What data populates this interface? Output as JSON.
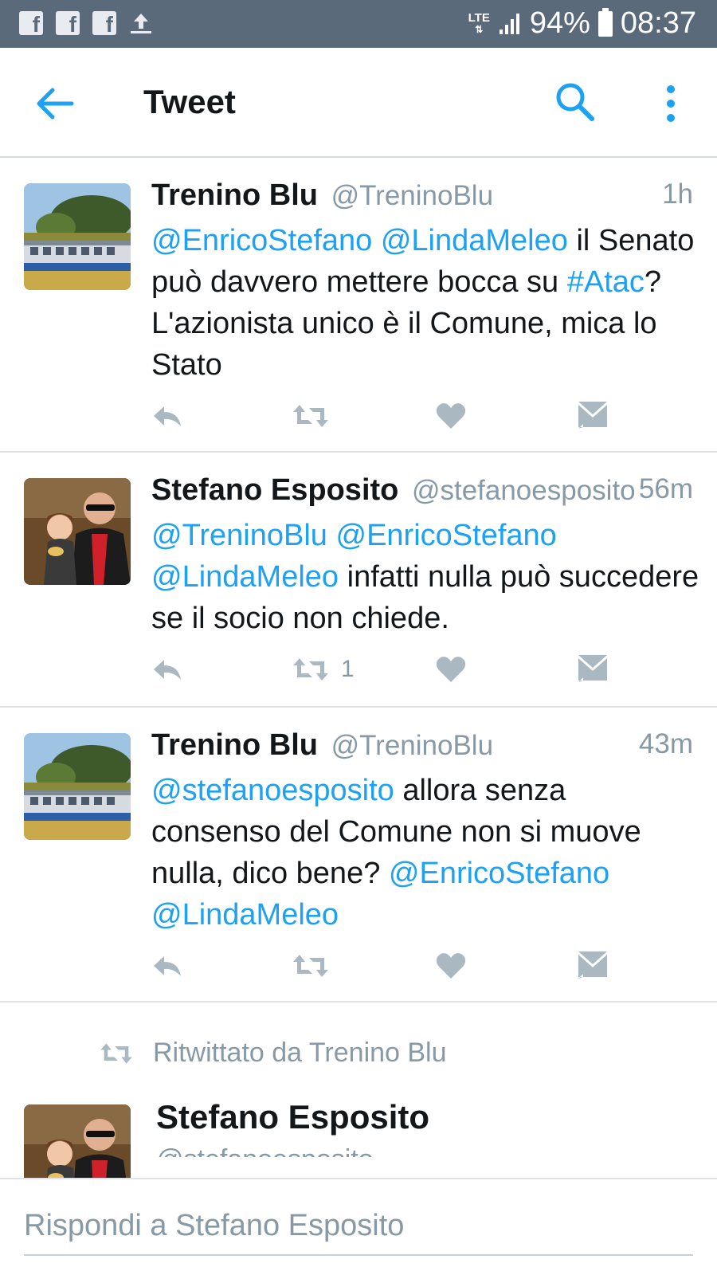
{
  "status_bar": {
    "network": "LTE",
    "battery": "94%",
    "time": "08:37"
  },
  "appbar": {
    "title": "Tweet"
  },
  "tweets": [
    {
      "name": "Trenino Blu",
      "handle": "@TreninoBlu",
      "time": "1h",
      "text": [
        {
          "t": "@EnricoStefano",
          "m": true
        },
        {
          "t": " ",
          "m": false
        },
        {
          "t": "@LindaMeleo",
          "m": true
        },
        {
          "t": " il Senato può davvero mettere bocca su ",
          "m": false
        },
        {
          "t": "#Atac",
          "m": true
        },
        {
          "t": "? L'azionista unico è il Comune, mica lo Stato",
          "m": false
        }
      ],
      "retweet_count": ""
    },
    {
      "name": "Stefano Esposito",
      "handle": "@stefanoesposito",
      "time": "56m",
      "text": [
        {
          "t": "@TreninoBlu",
          "m": true
        },
        {
          "t": " ",
          "m": false
        },
        {
          "t": "@EnricoStefano",
          "m": true
        },
        {
          "t": " ",
          "m": false
        },
        {
          "t": "@LindaMeleo",
          "m": true
        },
        {
          "t": " infatti nulla può succedere se il socio non chiede.",
          "m": false
        }
      ],
      "retweet_count": "1"
    },
    {
      "name": "Trenino Blu",
      "handle": "@TreninoBlu",
      "time": "43m",
      "text": [
        {
          "t": "@stefanoesposito",
          "m": true
        },
        {
          "t": " allora senza consenso del Comune non si muove nulla, dico bene? ",
          "m": false
        },
        {
          "t": "@EnricoStefano",
          "m": true
        },
        {
          "t": " ",
          "m": false
        },
        {
          "t": "@LindaMeleo",
          "m": true
        }
      ],
      "retweet_count": ""
    }
  ],
  "retweeted": {
    "label": "Ritwittato da Trenino Blu",
    "name": "Stefano Esposito",
    "handle": "@stefanoesposito"
  },
  "reply": {
    "placeholder": "Rispondi a Stefano Esposito"
  },
  "colors": {
    "accent": "#1da1f2",
    "status_bar": "#5b6a7a",
    "muted": "#8899a6",
    "action_icon": "#aab8c2"
  },
  "icons": [
    "facebook-icon",
    "upload-icon",
    "signal-icon",
    "battery-icon",
    "back-arrow-icon",
    "search-icon",
    "more-vert-icon",
    "reply-icon",
    "retweet-icon",
    "like-icon",
    "message-icon"
  ]
}
